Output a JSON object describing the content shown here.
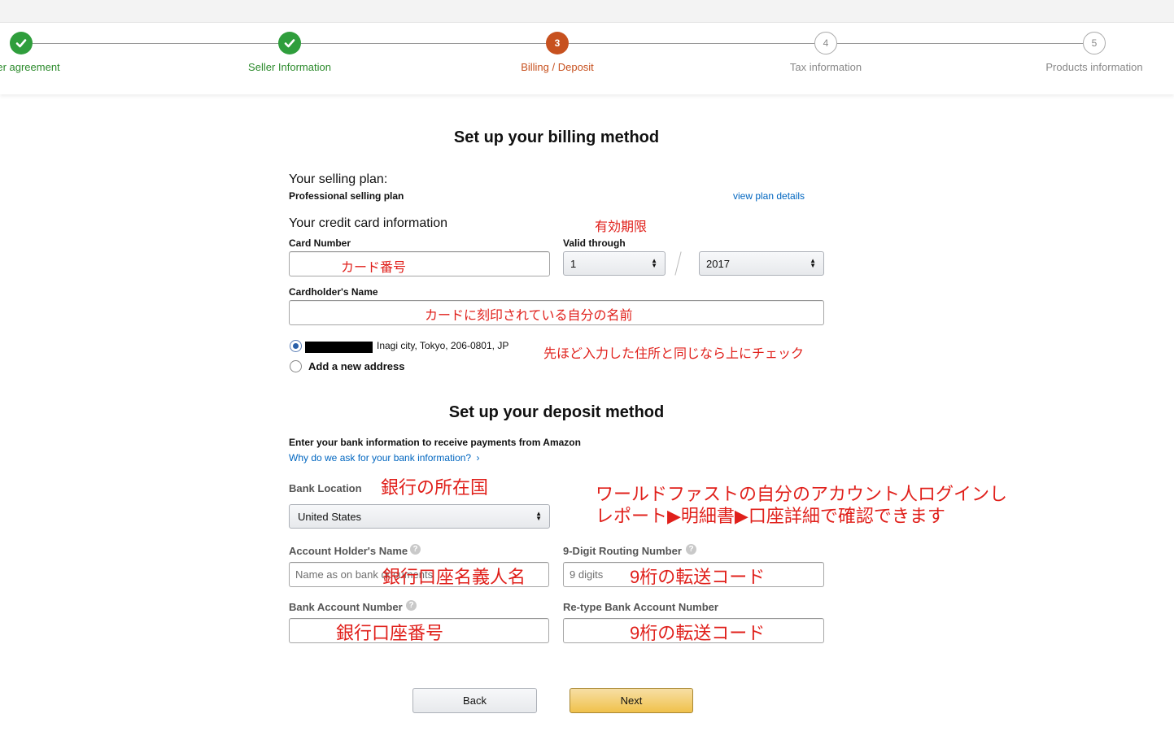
{
  "stepper": {
    "steps": [
      {
        "label": "er agreement",
        "state": "done"
      },
      {
        "label": "Seller Information",
        "state": "done"
      },
      {
        "label": "Billing / Deposit",
        "state": "active",
        "number": "3"
      },
      {
        "label": "Tax information",
        "state": "todo",
        "number": "4"
      },
      {
        "label": "Products information",
        "state": "todo",
        "number": "5"
      }
    ]
  },
  "billing": {
    "title": "Set up your billing method",
    "plan_heading": "Your selling plan:",
    "plan_name": "Professional selling plan",
    "plan_link": "view plan details",
    "card_heading": "Your credit card information",
    "card_number_label": "Card Number",
    "card_number_value": "",
    "valid_through_label": "Valid through",
    "month_value": "1",
    "year_value": "2017",
    "cardholder_label": "Cardholder's Name",
    "cardholder_value": "",
    "address_existing": "Inagi city, Tokyo, 206-0801, JP",
    "address_new": "Add a new address"
  },
  "deposit": {
    "title": "Set up your deposit method",
    "intro": "Enter your bank information to receive payments from Amazon",
    "why_link": "Why do we ask for your bank information?",
    "why_chevron": "›",
    "bank_location_label": "Bank Location",
    "bank_location_value": "United States",
    "holder_label": "Account Holder's Name",
    "holder_placeholder": "Name as on bank documents",
    "routing_label": "9-Digit Routing Number",
    "routing_placeholder": "9 digits",
    "account_label": "Bank Account Number",
    "retype_label": "Re-type Bank Account Number",
    "help_glyph": "?"
  },
  "buttons": {
    "back": "Back",
    "next": "Next"
  },
  "annotations": {
    "expiry": "有効期限",
    "card_number": "カード番号",
    "cardholder": "カードに刻印されている自分の名前",
    "address": "先ほど入力した住所と同じなら上にチェック",
    "bank_country": "銀行の所在国",
    "info_line1": "ワールドファストの自分のアカウント人ログインし",
    "info_line2": "レポート▶明細書▶口座詳細で確認できます",
    "holder": "銀行口座名義人名",
    "routing": "9桁の転送コード",
    "account": "銀行口座番号",
    "retype": "9桁の転送コード"
  },
  "colors": {
    "done": "#2f9e3c",
    "active": "#c7511f",
    "link": "#0066c0",
    "annotation": "#e0201b",
    "primary_button": "#f0c14b"
  }
}
